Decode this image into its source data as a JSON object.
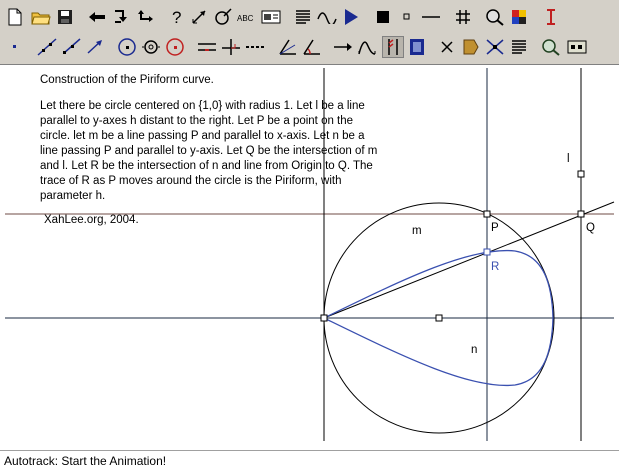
{
  "toolbar": {
    "row1": [
      "new-file",
      "open-folder",
      "save",
      "undo",
      "redo",
      "redo-alt",
      "help",
      "edit-arrow",
      "rotate",
      "text-abc",
      "image",
      "text-lines",
      "wave",
      "play",
      "filled-square",
      "small-square",
      "line-segment",
      "grid",
      "zoom",
      "color",
      "text-cursor"
    ],
    "row2": [
      "point",
      "line",
      "ray",
      "vector",
      "circle",
      "circle-center",
      "circle-point",
      "parallel",
      "perpendicular",
      "dashed",
      "angle-bisector",
      "angle",
      "arrow-both",
      "function",
      "animate",
      "film",
      "cross",
      "pentagon",
      "intersect",
      "list",
      "zoom-fit",
      "macro"
    ]
  },
  "description": {
    "title": "Construction of the Piriform curve.",
    "body_lines": [
      "Let there be circle centered on {1,0} with radius 1. Let l be a line",
      "parallel to y-axes h distant to the right. Let P be a point on the",
      "circle. let m be a line passing P and parallel to x-axis. Let n be a",
      "line passing P and parallel to y-axis. Let Q be the intersection of m",
      "and l. Let R be the intersection of n and line from Origin to Q. The",
      "trace of R as P moves around the circle is the Piriform, with",
      "parameter h."
    ],
    "credit": "XahLee.org, 2004."
  },
  "labels": {
    "l": "l",
    "m": "m",
    "n": "n",
    "P": "P",
    "Q": "Q",
    "R": "R"
  },
  "colors": {
    "curve": "#3a50b0",
    "label_R": "#3a50b0",
    "horizontal_m": "#8c6f6a",
    "lines": "#000000"
  },
  "status": {
    "text": "Autotrack: Start the Animation!"
  }
}
